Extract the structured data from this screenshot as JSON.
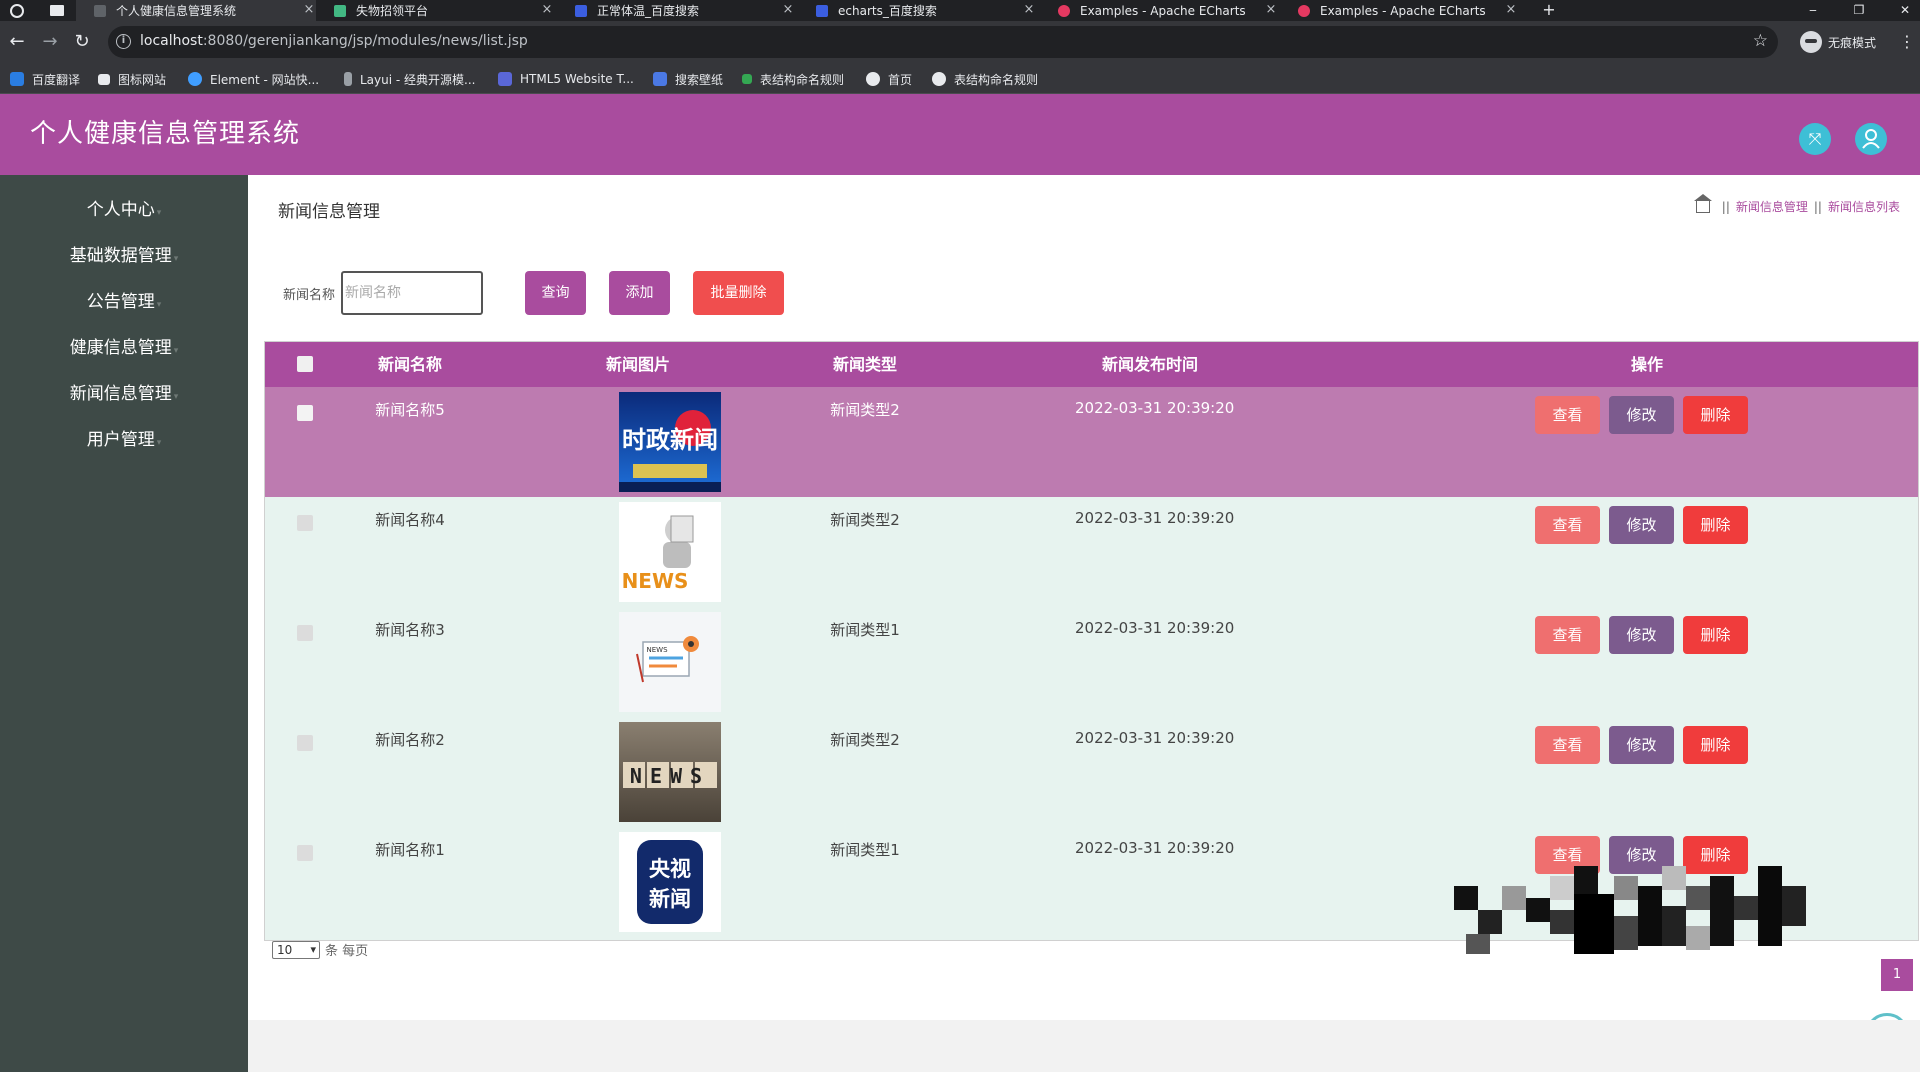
{
  "browser": {
    "tabs": [
      {
        "title": "个人健康信息管理系统",
        "active": true
      },
      {
        "title": "失物招领平台",
        "active": false
      },
      {
        "title": "正常体温_百度搜索",
        "active": false
      },
      {
        "title": "echarts_百度搜索",
        "active": false
      },
      {
        "title": "Examples - Apache ECharts",
        "active": false
      },
      {
        "title": "Examples - Apache ECharts",
        "active": false
      }
    ],
    "new_tab": "+",
    "close_glyph": "×",
    "url_host": "localhost",
    "url_path": ":8080/gerenjiankang/jsp/modules/news/list.jsp",
    "incognito_label": "无痕模式",
    "bookmarks": [
      "百度翻译",
      "图标网站",
      "Element - 网站快...",
      "Layui - 经典开源模...",
      "HTML5 Website T...",
      "搜索壁纸",
      "表结构命名规则",
      "首页",
      "表结构命名规则"
    ]
  },
  "app": {
    "title": "个人健康信息管理系统",
    "theme_color": "#a94c9e",
    "header_icons": [
      "fullscreen-icon",
      "user-icon"
    ]
  },
  "sidebar": {
    "items": [
      "个人中心",
      "基础数据管理",
      "公告管理",
      "健康信息管理",
      "新闻信息管理",
      "用户管理"
    ]
  },
  "page": {
    "heading": "新闻信息管理",
    "breadcrumb": [
      "新闻信息管理",
      "新闻信息列表"
    ]
  },
  "search": {
    "label": "新闻名称",
    "placeholder": "新闻名称",
    "query_button": "查询",
    "add_button": "添加",
    "batch_delete_button": "批量删除"
  },
  "table": {
    "headers": [
      "新闻名称",
      "新闻图片",
      "新闻类型",
      "新闻发布时间",
      "操作"
    ],
    "rows": [
      {
        "name": "新闻名称5",
        "image": "时政新闻",
        "type": "新闻类型2",
        "time": "2022-03-31 20:39:20"
      },
      {
        "name": "新闻名称4",
        "image": "NEWS",
        "type": "新闻类型2",
        "time": "2022-03-31 20:39:20"
      },
      {
        "name": "新闻名称3",
        "image": "NEWS",
        "type": "新闻类型1",
        "time": "2022-03-31 20:39:20"
      },
      {
        "name": "新闻名称2",
        "image": "NEWS",
        "type": "新闻类型2",
        "time": "2022-03-31 20:39:20"
      },
      {
        "name": "新闻名称1",
        "image": "央视新闻",
        "type": "新闻类型1",
        "time": "2022-03-31 20:39:20"
      }
    ],
    "actions": {
      "view": "查看",
      "edit": "修改",
      "delete": "删除"
    }
  },
  "pagination": {
    "page_size": "10",
    "page_size_suffix": "条 每页",
    "current_page": "1"
  }
}
